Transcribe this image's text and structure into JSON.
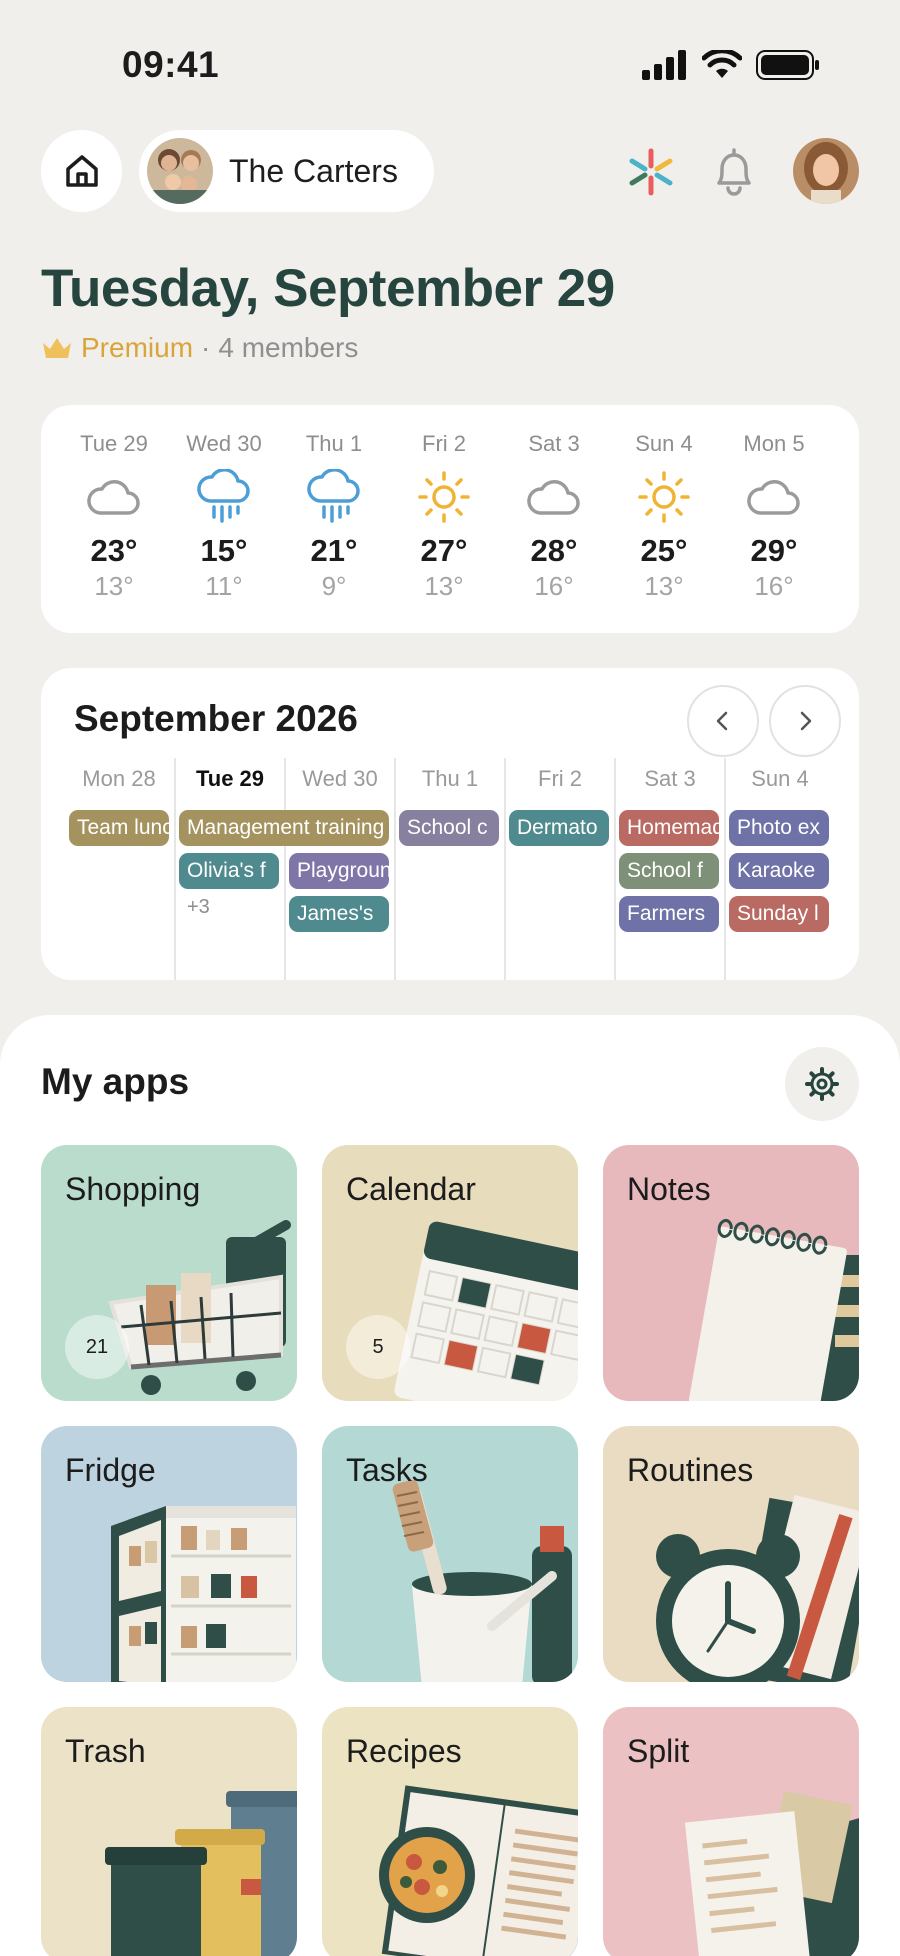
{
  "status": {
    "time": "09:41"
  },
  "header": {
    "family_name": "The Carters"
  },
  "date_title": "Tuesday, September 29",
  "subline": {
    "plan": "Premium",
    "separator": "·",
    "members": "4 members"
  },
  "weather": [
    {
      "day": "Tue 29",
      "icon": "cloud-icon",
      "high": "23°",
      "low": "13°"
    },
    {
      "day": "Wed 30",
      "icon": "rain-icon",
      "high": "15°",
      "low": "11°"
    },
    {
      "day": "Thu 1",
      "icon": "rain-icon",
      "high": "21°",
      "low": "9°"
    },
    {
      "day": "Fri 2",
      "icon": "sun-icon",
      "high": "27°",
      "low": "13°"
    },
    {
      "day": "Sat 3",
      "icon": "cloud-icon",
      "high": "28°",
      "low": "16°"
    },
    {
      "day": "Sun 4",
      "icon": "sun-icon",
      "high": "25°",
      "low": "13°"
    },
    {
      "day": "Mon 5",
      "icon": "cloud-icon",
      "high": "29°",
      "low": "16°"
    }
  ],
  "calendar": {
    "title": "September 2026",
    "days": [
      "Mon 28",
      "Tue 29",
      "Wed 30",
      "Thu 1",
      "Fri 2",
      "Sat 3",
      "Sun 4"
    ],
    "events": {
      "team_lunch": "Team lunch",
      "management_training": "Management training",
      "olivia": "Olivia's f",
      "more": "+3",
      "playground": "Playground",
      "james": "James's",
      "school": "School c",
      "dermato": "Dermato",
      "homemade": "Homemade",
      "school_f": "School f",
      "farmers": "Farmers",
      "photo": "Photo ex",
      "karaoke": "Karaoke",
      "sunday": "Sunday l"
    },
    "colors": {
      "olive": "#a5935f",
      "teal": "#4f8a8e",
      "purple": "#7f76a7",
      "grey_purple": "#87809e",
      "rust": "#b96a62",
      "sage": "#7e9078",
      "indigo": "#6e72a6"
    }
  },
  "apps": {
    "title": "My apps",
    "tiles": [
      {
        "label": "Shopping",
        "badge": "21",
        "bg": "#b9dccd"
      },
      {
        "label": "Calendar",
        "badge": "5",
        "bg": "#e7dcbb"
      },
      {
        "label": "Notes",
        "badge": "",
        "bg": "#e7b9bd"
      },
      {
        "label": "Fridge",
        "badge": "",
        "bg": "#bdd3df"
      },
      {
        "label": "Tasks",
        "badge": "",
        "bg": "#b4d8d3"
      },
      {
        "label": "Routines",
        "badge": "",
        "bg": "#e9dcc2"
      },
      {
        "label": "Trash",
        "badge": "",
        "bg": "#ece2c7"
      },
      {
        "label": "Recipes",
        "badge": "",
        "bg": "#ebe3c1"
      },
      {
        "label": "Split",
        "badge": "",
        "bg": "#ebc1c4"
      }
    ]
  }
}
